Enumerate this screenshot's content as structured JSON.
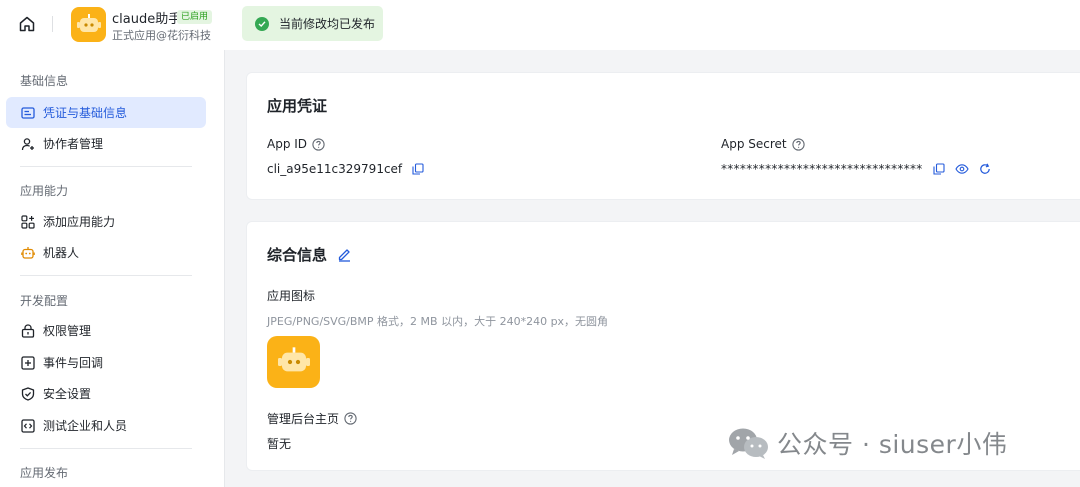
{
  "header": {
    "app_name": "claude助手",
    "status_badge": "已启用",
    "app_subtitle": "正式应用@花衍科技",
    "toast_text": "当前修改均已发布"
  },
  "sidebar": {
    "sections": [
      {
        "title": "基础信息"
      },
      {
        "title": "应用能力"
      },
      {
        "title": "开发配置"
      },
      {
        "title": "应用发布"
      }
    ],
    "items": [
      {
        "label": "凭证与基础信息",
        "icon": "credential-icon",
        "active": true
      },
      {
        "label": "协作者管理",
        "icon": "user-add-icon"
      },
      {
        "label": "添加应用能力",
        "icon": "apps-add-icon"
      },
      {
        "label": "机器人",
        "icon": "robot-icon"
      },
      {
        "label": "权限管理",
        "icon": "lock-icon"
      },
      {
        "label": "事件与回调",
        "icon": "event-icon"
      },
      {
        "label": "安全设置",
        "icon": "shield-icon"
      },
      {
        "label": "测试企业和人员",
        "icon": "code-icon"
      }
    ]
  },
  "credentials": {
    "title": "应用凭证",
    "app_id_label": "App ID",
    "app_id_value": "cli_a95e11c329791cef",
    "secret_label": "App Secret",
    "secret_value": "********************************"
  },
  "info": {
    "title": "综合信息",
    "icon_label": "应用图标",
    "icon_hint": "JPEG/PNG/SVG/BMP 格式，2 MB 以内，大于 240*240 px，无圆角",
    "homepage_label": "管理后台主页",
    "homepage_value": "暂无"
  },
  "watermark": {
    "text": "公众号 · siuser小伟"
  },
  "colors": {
    "accent": "#245bdb",
    "app_icon_bg": "#fbb217",
    "success": "#34a853",
    "success_bg": "#e4f5e1"
  }
}
